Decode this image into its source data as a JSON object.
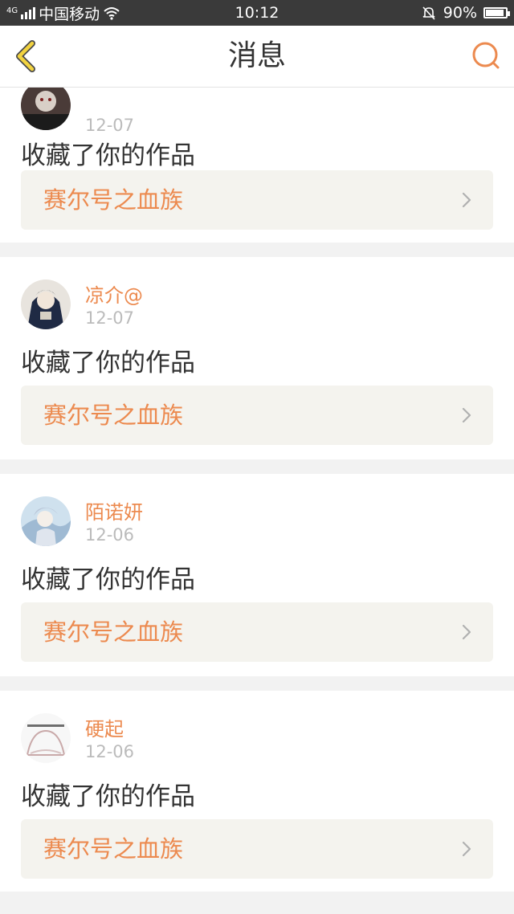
{
  "status_bar": {
    "carrier": "中国移动",
    "network": "4G",
    "time": "10:12",
    "battery": "90%",
    "battery_level": 0.9
  },
  "nav": {
    "title": "消息",
    "back_icon": "chevron-left-icon",
    "search_icon": "search-icon"
  },
  "accent_color": "#ec8a4f",
  "items": [
    {
      "username": "",
      "date": "12-07",
      "action": "收藏了你的作品",
      "work": "赛尔号之血族"
    },
    {
      "username": "凉介@",
      "date": "12-07",
      "action": "收藏了你的作品",
      "work": "赛尔号之血族"
    },
    {
      "username": "陌诺妍",
      "date": "12-06",
      "action": "收藏了你的作品",
      "work": "赛尔号之血族"
    },
    {
      "username": "硬起",
      "date": "12-06",
      "action": "收藏了你的作品",
      "work": "赛尔号之血族"
    }
  ]
}
